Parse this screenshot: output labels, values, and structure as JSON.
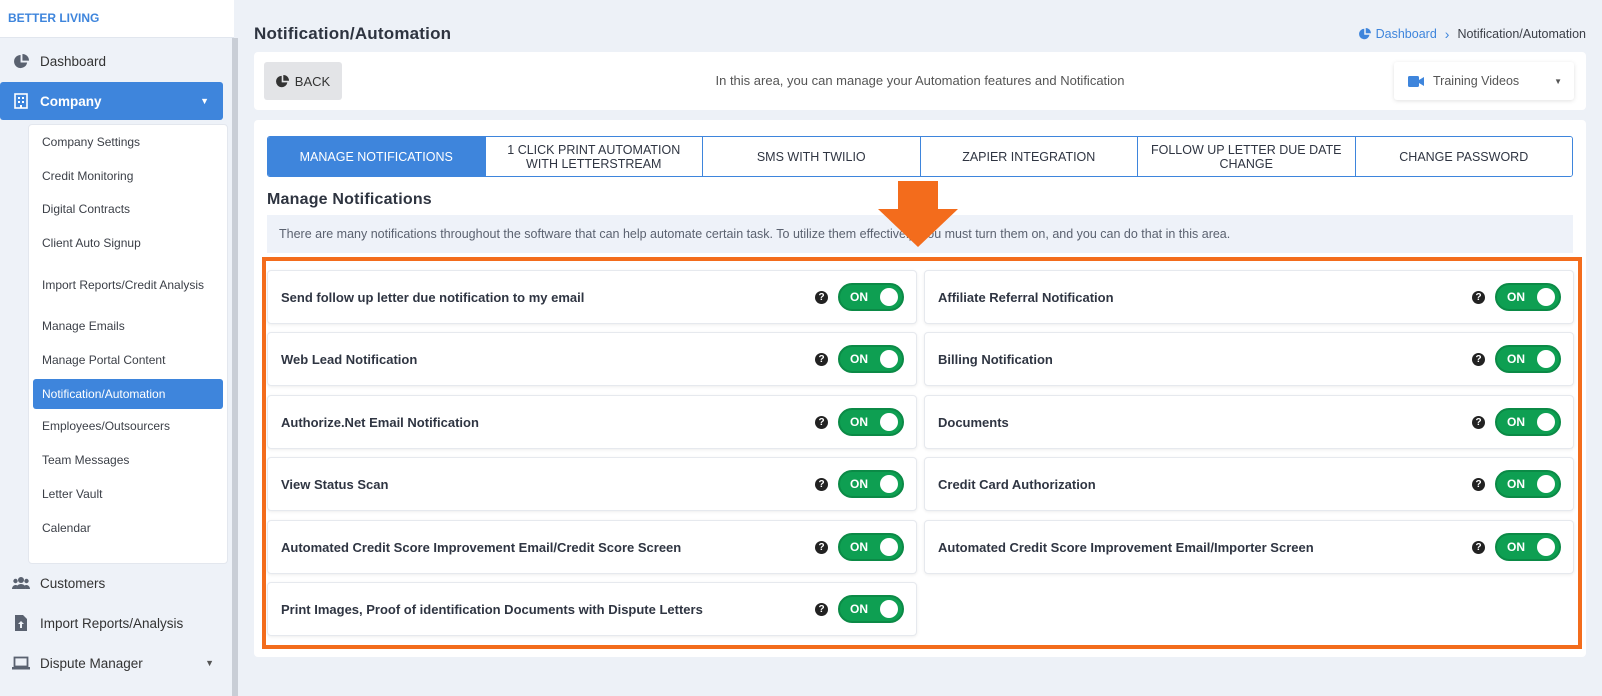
{
  "brand": "BETTER LIVING",
  "sidebar": {
    "dashboard": "Dashboard",
    "company": "Company",
    "submenu": [
      "Company Settings",
      "Credit Monitoring",
      "Digital Contracts",
      "Client Auto Signup",
      "Import Reports/Credit Analysis",
      "Manage Emails",
      "Manage Portal Content",
      "Notification/Automation",
      "Employees/Outsourcers",
      "Team Messages",
      "Letter Vault",
      "Calendar"
    ],
    "customers": "Customers",
    "import_reports": "Import Reports/Analysis",
    "dispute_manager": "Dispute Manager"
  },
  "header": {
    "title": "Notification/Automation",
    "breadcrumb_link": "Dashboard",
    "breadcrumb_current": "Notification/Automation"
  },
  "topbar": {
    "back_label": "BACK",
    "message": "In this area, you can manage your Automation features and Notification",
    "training_label": "Training Videos"
  },
  "tabs": [
    "MANAGE NOTIFICATIONS",
    "1 CLICK PRINT AUTOMATION WITH LETTERSTREAM",
    "SMS WITH TWILIO",
    "ZAPIER INTEGRATION",
    "FOLLOW UP LETTER DUE DATE CHANGE",
    "CHANGE PASSWORD"
  ],
  "section": {
    "title": "Manage Notifications",
    "info": "There are many notifications throughout the software that can help automate certain task. To utilize them effectively, you must turn them on, and you can do that in this area."
  },
  "notifications": [
    {
      "label": "Send follow up letter due notification to my email",
      "state": "ON"
    },
    {
      "label": "Affiliate Referral Notification",
      "state": "ON"
    },
    {
      "label": "Web Lead Notification",
      "state": "ON"
    },
    {
      "label": "Billing Notification",
      "state": "ON"
    },
    {
      "label": "Authorize.Net Email Notification",
      "state": "ON"
    },
    {
      "label": "Documents",
      "state": "ON"
    },
    {
      "label": "View Status Scan",
      "state": "ON"
    },
    {
      "label": "Credit Card Authorization",
      "state": "ON"
    },
    {
      "label": "Automated Credit Score Improvement Email/Credit Score Screen",
      "state": "ON"
    },
    {
      "label": "Automated Credit Score Improvement Email/Importer Screen",
      "state": "ON"
    },
    {
      "label": "Print Images, Proof of identification Documents with Dispute Letters",
      "state": "ON"
    }
  ],
  "help_glyph": "?",
  "colors": {
    "accent": "#3e85dc",
    "toggle_on": "#0e9f52",
    "highlight": "#f36c1c"
  }
}
